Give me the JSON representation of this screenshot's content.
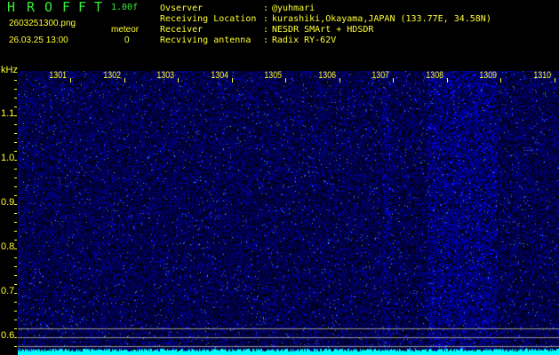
{
  "app": {
    "title_letters": [
      "H",
      "R",
      "O",
      "F",
      "F",
      "T"
    ],
    "version": "1.00f"
  },
  "file": {
    "name": "2603251300.png",
    "datetime": "26.03.25 13:00"
  },
  "meteor": {
    "label": "meteor",
    "count": "0"
  },
  "info": [
    {
      "label": "Ovserver",
      "value": "@yuhmari"
    },
    {
      "label": "Receiving Location",
      "value": "kurashiki,Okayama,JAPAN (133.77E, 34.58N)"
    },
    {
      "label": "Receiver",
      "value": "NESDR SMArt + HDSDR"
    },
    {
      "label": "Recviving antenna",
      "value": "Radix RY-62V"
    }
  ],
  "axis": {
    "y_unit": "kHz",
    "y_labels": [
      "1.1",
      "1.0",
      "0.9",
      "0.8",
      "0.7",
      "0.6"
    ],
    "time_labels": [
      "1301",
      "1302",
      "1303",
      "1304",
      "1305",
      "1306",
      "1307",
      "1308",
      "1309",
      "1310"
    ]
  },
  "colors": {
    "text": "#ffff33",
    "title": "#33ee33",
    "signal": "#2030ff",
    "baseline": "#00ffff"
  }
}
